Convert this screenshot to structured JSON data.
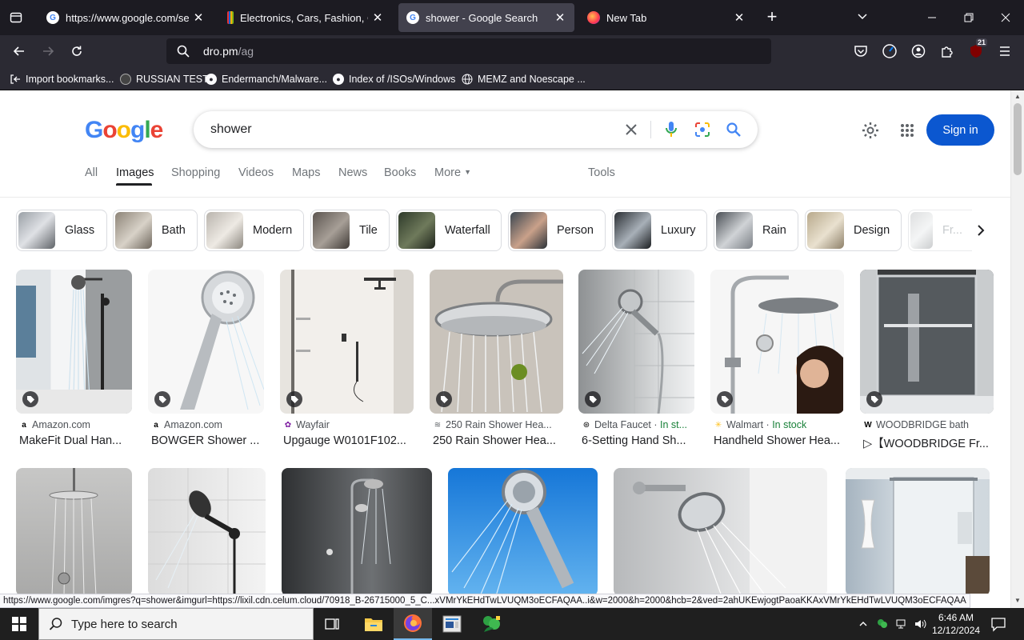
{
  "browser": {
    "tabs": [
      {
        "label": "https://www.google.com/searc",
        "favicon": "google-g-icon",
        "active": false
      },
      {
        "label": "Electronics, Cars, Fashion, Colle",
        "favicon": "ebay-icon",
        "active": false
      },
      {
        "label": "shower - Google Search",
        "favicon": "google-g-icon",
        "active": true
      },
      {
        "label": "New Tab",
        "favicon": "firefox-icon",
        "active": false
      }
    ],
    "url_main": "dro.pm",
    "url_path": "/ag",
    "addon_badge": "21",
    "bookmarks": [
      {
        "label": "Import bookmarks...",
        "icon": "import-icon"
      },
      {
        "label": "RUSSIAN TEST",
        "icon": "globe-icon"
      },
      {
        "label": "Endermanch/Malware...",
        "icon": "github-icon"
      },
      {
        "label": "Index of /ISOs/Windows",
        "icon": "github-icon"
      },
      {
        "label": "MEMZ and Noescape ...",
        "icon": "globe-icon"
      }
    ],
    "status_url": "https://www.google.com/imgres?q=shower&imgurl=https://lixil.cdn.celum.cloud/70918_B-26715000_5_C...xVMrYkEHdTwLVUQM3oECFAQAA..i&w=2000&h=2000&hcb=2&ved=2ahUKEwjogtPaoaKKAxVMrYkEHdTwLVUQM3oECFAQAA"
  },
  "google": {
    "query": "shower",
    "sign_in": "Sign in",
    "tabs": [
      "All",
      "Images",
      "Shopping",
      "Videos",
      "Maps",
      "News",
      "Books",
      "More",
      "Tools"
    ],
    "chips": [
      "Glass",
      "Bath",
      "Modern",
      "Tile",
      "Waterfall",
      "Person",
      "Luxury",
      "Rain",
      "Design",
      "Fr..."
    ],
    "results_row1": [
      {
        "source": "Amazon.com",
        "title": "MakeFit Dual Han...",
        "stock": ""
      },
      {
        "source": "Amazon.com",
        "title": "BOWGER Shower ...",
        "stock": ""
      },
      {
        "source": "Wayfair",
        "title": "Upgauge W0101F102...",
        "stock": ""
      },
      {
        "source": "250 Rain Shower Hea...",
        "title": "250 Rain Shower Hea...",
        "stock": ""
      },
      {
        "source": "Delta Faucet",
        "title": "6-Setting Hand Sh...",
        "stock": "In st..."
      },
      {
        "source": "Walmart",
        "title": "Handheld Shower Hea...",
        "stock": "In stock"
      },
      {
        "source": "WOODBRIDGE bath",
        "title": "▷【WOODBRIDGE Fr...",
        "stock": ""
      }
    ]
  },
  "taskbar": {
    "search_placeholder": "Type here to search",
    "time": "6:46 AM",
    "date": "12/12/2024"
  }
}
